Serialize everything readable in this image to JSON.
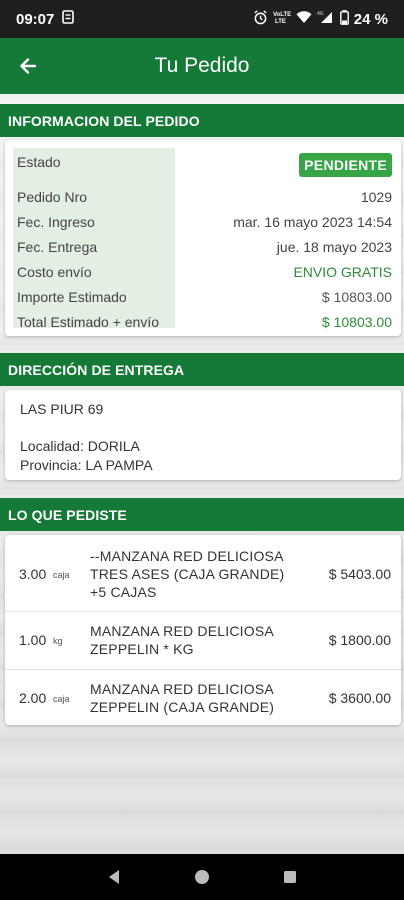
{
  "status_bar": {
    "time": "09:07",
    "battery": "24 %",
    "network": "4G"
  },
  "app_bar": {
    "title": "Tu Pedido",
    "back_icon": "arrow-left-icon"
  },
  "order_info": {
    "header": "INFORMACION DEL PEDIDO",
    "status_label": "Estado",
    "status_value": "PENDIENTE",
    "rows": [
      {
        "label": "Pedido Nro",
        "value": "1029"
      },
      {
        "label": "Fec. Ingreso",
        "value": "mar. 16 mayo 2023 14:54"
      },
      {
        "label": "Fec. Entrega",
        "value": "jue. 18 mayo 2023"
      },
      {
        "label": "Costo envío",
        "value": "ENVIO GRATIS"
      },
      {
        "label": "Importe Estimado",
        "value": "$ 10803.00"
      },
      {
        "label": "Total Estimado + envío",
        "value": "$ 10803.00"
      }
    ]
  },
  "delivery": {
    "header": "DIRECCIÓN DE ENTREGA",
    "address": "LAS PIUR 69",
    "locality": "Localidad: DORILA",
    "province": "Provincia: LA PAMPA"
  },
  "items": {
    "header": "LO QUE PEDISTE",
    "list": [
      {
        "qty": "3.00",
        "unit": "caja",
        "desc": [
          "--MANZANA RED DELICIOSA",
          "TRES ASES (CAJA GRANDE)",
          "+5 CAJAS"
        ],
        "price": "$ 5403.00"
      },
      {
        "qty": "1.00",
        "unit": "kg",
        "desc": [
          "MANZANA RED DELICIOSA",
          "ZEPPELIN * KG"
        ],
        "price": "$ 1800.00"
      },
      {
        "qty": "2.00",
        "unit": "caja",
        "desc": [
          "MANZANA RED DELICIOSA",
          "ZEPPELIN (CAJA GRANDE)"
        ],
        "price": "$ 3600.00"
      }
    ]
  },
  "colors": {
    "primary": "#157a37",
    "badge": "#36a546",
    "green_text": "#2f8a3b",
    "label_bg": "#e3efe2"
  }
}
